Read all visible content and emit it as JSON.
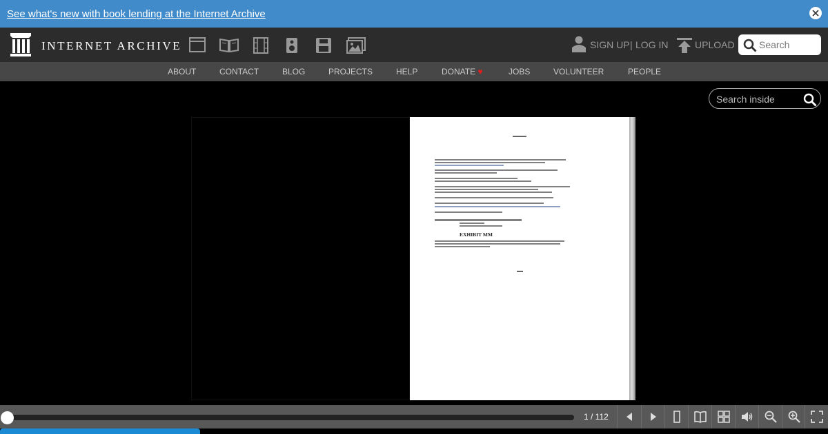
{
  "banner": {
    "link_text": "See what's new with book lending at the Internet Archive"
  },
  "header": {
    "logo_text": "INTERNET ARCHIVE",
    "sign_up": "SIGN UP",
    "separator": "|",
    "log_in": "LOG IN",
    "upload": "UPLOAD",
    "search_placeholder": "Search"
  },
  "media_icons": [
    "web-icon",
    "texts-icon",
    "video-icon",
    "audio-icon",
    "software-icon",
    "images-icon"
  ],
  "subnav": {
    "items": [
      "ABOUT",
      "CONTACT",
      "BLOG",
      "PROJECTS",
      "HELP",
      "DONATE",
      "JOBS",
      "VOLUNTEER",
      "PEOPLE"
    ],
    "donate_heart": "♥"
  },
  "viewer": {
    "search_inside_placeholder": "Search inside",
    "document": {
      "exhibit": "EXHIBIT MM"
    }
  },
  "toolbar": {
    "page_count": "1 / 112",
    "current_page": 1,
    "total_pages": 112,
    "buttons": [
      "prev-page-icon",
      "next-page-icon",
      "one-page-icon",
      "two-page-icon",
      "thumbnail-icon",
      "read-aloud-icon",
      "zoom-out-icon",
      "zoom-in-icon",
      "fullscreen-icon"
    ]
  },
  "colors": {
    "banner": "#428bca",
    "topnav": "#2c2c2c",
    "subnav": "#474747",
    "toolbar": "#585858",
    "heart": "#e81c1c",
    "progress_bar": "#1a8ad4"
  }
}
